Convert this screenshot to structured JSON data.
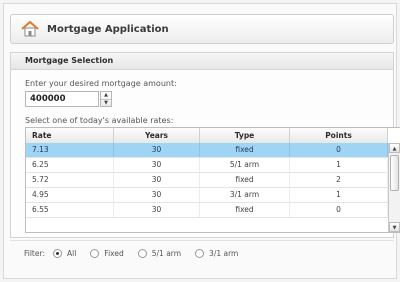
{
  "window": {
    "title": "Mortgage Application"
  },
  "panel": {
    "header": "Mortgage Selection",
    "amount_prompt": "Enter your desired mortgage amount:",
    "amount_value": "400000",
    "rates_prompt": "Select one of today's available rates:"
  },
  "grid": {
    "columns": [
      "Rate",
      "Years",
      "Type",
      "Points"
    ],
    "rows": [
      {
        "rate": "7.13",
        "years": "30",
        "type": "fixed",
        "points": "0"
      },
      {
        "rate": "6.25",
        "years": "30",
        "type": "5/1 arm",
        "points": "1"
      },
      {
        "rate": "5.72",
        "years": "30",
        "type": "fixed",
        "points": "2"
      },
      {
        "rate": "4.95",
        "years": "30",
        "type": "3/1 arm",
        "points": "1"
      },
      {
        "rate": "6.55",
        "years": "30",
        "type": "fixed",
        "points": "0"
      }
    ],
    "selected_index": 0
  },
  "filter": {
    "label": "Filter:",
    "options": [
      "All",
      "Fixed",
      "5/1 arm",
      "3/1 arm"
    ],
    "selected": "All"
  },
  "icons": {
    "home": "home-icon",
    "spinner_up": "up-arrow-icon",
    "spinner_down": "down-arrow-icon"
  },
  "colors": {
    "selected_row": "#9fd4f5",
    "home_icon": "#e07a2e"
  }
}
